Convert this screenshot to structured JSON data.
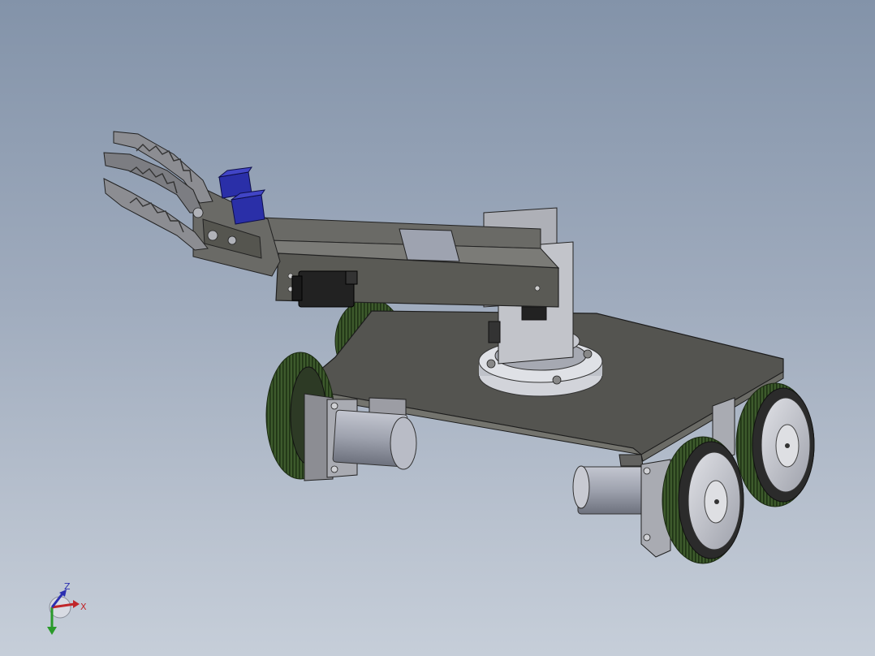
{
  "viewport": {
    "background_top": "#8393a9",
    "background_bottom": "#c6ced9"
  },
  "model": {
    "plate_color": "#545450",
    "arm_color": "#5a5a55",
    "servo_dark_color": "#222222",
    "servo_blue_color": "#2a2fa8",
    "wheel_tread_color": "#3d5a2c",
    "hub_color": "#c8c8ce",
    "motor_color": "#9ea2ae"
  },
  "triad": {
    "x_label": "X",
    "z_label": "Z",
    "x_color": "#c0262a",
    "y_color": "#2a9a2a",
    "z_color": "#2b2fb0"
  }
}
